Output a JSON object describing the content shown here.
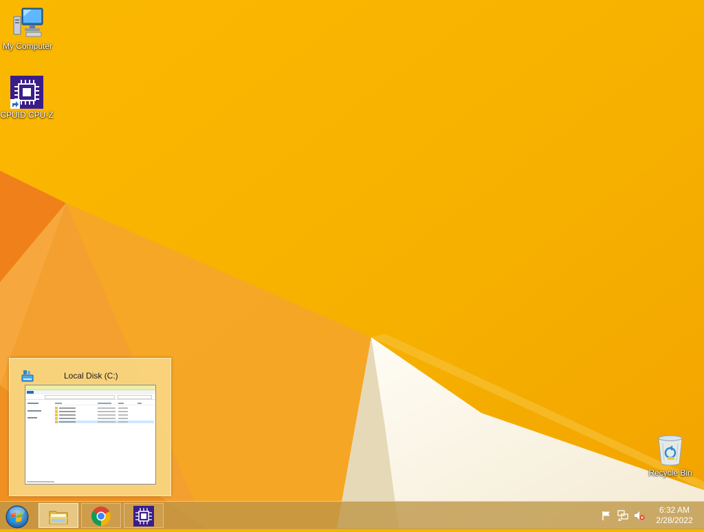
{
  "desktop": {
    "icons": [
      {
        "label": "My Computer",
        "icon": "computer-icon"
      },
      {
        "label": "CPUID CPU-Z",
        "icon": "cpu-z-icon"
      },
      {
        "label": "Recycle Bin",
        "icon": "recycle-bin-icon"
      }
    ]
  },
  "thumbnail": {
    "title": "Local Disk (C:)",
    "icon": "drive-icon"
  },
  "taskbar": {
    "start": "start-orb-icon",
    "buttons": [
      {
        "name": "file-explorer",
        "icon": "folder-icon",
        "active": true
      },
      {
        "name": "chrome",
        "icon": "chrome-icon",
        "active": false
      },
      {
        "name": "cpu-z",
        "icon": "cpu-z-icon",
        "active": false
      }
    ],
    "tray": [
      "action-center-flag-icon",
      "network-icon",
      "volume-muted-icon"
    ],
    "clock": {
      "time": "6:32 AM",
      "date": "2/28/2022"
    }
  },
  "colors": {
    "wallpaper": "#f6b400",
    "cpuz_purple": "#3b1d8a",
    "taskbar": "#be9646"
  }
}
